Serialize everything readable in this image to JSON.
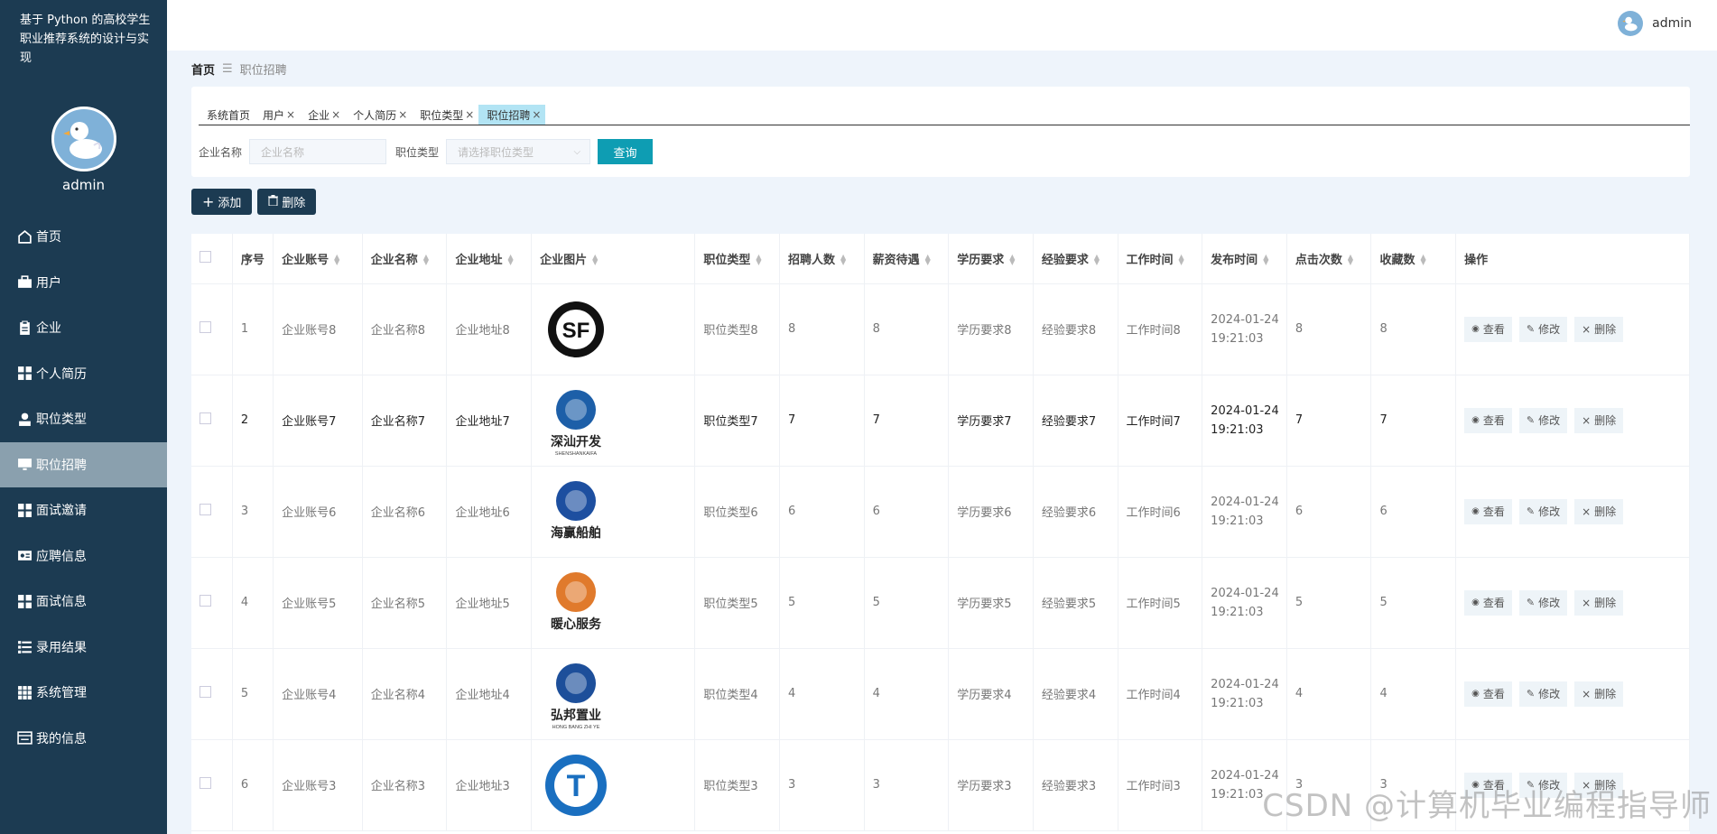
{
  "app": {
    "title": "基于 Python 的高校学生职业推荐系统的设计与实现"
  },
  "user": {
    "name": "admin"
  },
  "menu": [
    {
      "label": "首页",
      "icon": "home-icon"
    },
    {
      "label": "用户",
      "icon": "briefcase-icon"
    },
    {
      "label": "企业",
      "icon": "clipboard-icon"
    },
    {
      "label": "个人简历",
      "icon": "grid-icon"
    },
    {
      "label": "职位类型",
      "icon": "person-icon"
    },
    {
      "label": "职位招聘",
      "icon": "monitor-icon",
      "active": true
    },
    {
      "label": "面试邀请",
      "icon": "grid-icon"
    },
    {
      "label": "应聘信息",
      "icon": "id-card-icon"
    },
    {
      "label": "面试信息",
      "icon": "grid-icon"
    },
    {
      "label": "录用结果",
      "icon": "list-icon"
    },
    {
      "label": "系统管理",
      "icon": "apps-icon"
    },
    {
      "label": "我的信息",
      "icon": "profile-card-icon"
    }
  ],
  "breadcrumb": {
    "home": "首页",
    "current": "职位招聘"
  },
  "tabs": [
    {
      "label": "系统首页",
      "closable": false
    },
    {
      "label": "用户",
      "closable": true
    },
    {
      "label": "企业",
      "closable": true
    },
    {
      "label": "个人简历",
      "closable": true
    },
    {
      "label": "职位类型",
      "closable": true
    },
    {
      "label": "职位招聘",
      "closable": true,
      "active": true
    }
  ],
  "search": {
    "company_label": "企业名称",
    "company_placeholder": "企业名称",
    "type_label": "职位类型",
    "type_placeholder": "请选择职位类型",
    "query_button": "查询"
  },
  "actions": {
    "add": "添加",
    "delete": "删除"
  },
  "table": {
    "headers": [
      "序号",
      "企业账号",
      "企业名称",
      "企业地址",
      "企业图片",
      "职位类型",
      "招聘人数",
      "薪资待遇",
      "学历要求",
      "经验要求",
      "工作时间",
      "发布时间",
      "点击次数",
      "收藏数",
      "操作"
    ],
    "op_labels": {
      "view": "查看",
      "edit": "修改",
      "delete": "删除"
    },
    "rows": [
      {
        "no": "1",
        "account": "企业账号8",
        "name": "企业名称8",
        "address": "企业地址8",
        "logo": "SF",
        "type": "职位类型8",
        "count": "8",
        "salary": "8",
        "edu": "学历要求8",
        "exp": "经验要求8",
        "time": "工作时间8",
        "pub_date": "2024-01-24",
        "pub_time": "19:21:03",
        "clicks": "8",
        "favs": "8"
      },
      {
        "no": "2",
        "account": "企业账号7",
        "name": "企业名称7",
        "address": "企业地址7",
        "logo": "深汕开发",
        "logo_sub": "SHENSHANKAIFA",
        "type": "职位类型7",
        "count": "7",
        "salary": "7",
        "edu": "学历要求7",
        "exp": "经验要求7",
        "time": "工作时间7",
        "pub_date": "2024-01-24",
        "pub_time": "19:21:03",
        "clicks": "7",
        "favs": "7"
      },
      {
        "no": "3",
        "account": "企业账号6",
        "name": "企业名称6",
        "address": "企业地址6",
        "logo": "海赢船舶",
        "type": "职位类型6",
        "count": "6",
        "salary": "6",
        "edu": "学历要求6",
        "exp": "经验要求6",
        "time": "工作时间6",
        "pub_date": "2024-01-24",
        "pub_time": "19:21:03",
        "clicks": "6",
        "favs": "6"
      },
      {
        "no": "4",
        "account": "企业账号5",
        "name": "企业名称5",
        "address": "企业地址5",
        "logo": "暖心服务",
        "type": "职位类型5",
        "count": "5",
        "salary": "5",
        "edu": "学历要求5",
        "exp": "经验要求5",
        "time": "工作时间5",
        "pub_date": "2024-01-24",
        "pub_time": "19:21:03",
        "clicks": "5",
        "favs": "5"
      },
      {
        "no": "5",
        "account": "企业账号4",
        "name": "企业名称4",
        "address": "企业地址4",
        "logo": "弘邦置业",
        "logo_sub": "HONG BANG ZHI YE",
        "type": "职位类型4",
        "count": "4",
        "salary": "4",
        "edu": "学历要求4",
        "exp": "经验要求4",
        "time": "工作时间4",
        "pub_date": "2024-01-24",
        "pub_time": "19:21:03",
        "clicks": "4",
        "favs": "4"
      },
      {
        "no": "6",
        "account": "企业账号3",
        "name": "企业名称3",
        "address": "企业地址3",
        "logo": "T",
        "type": "职位类型3",
        "count": "3",
        "salary": "3",
        "edu": "学历要求3",
        "exp": "经验要求3",
        "time": "工作时间3",
        "pub_date": "2024-01-24",
        "pub_time": "19:21:03",
        "clicks": "3",
        "favs": "3"
      }
    ]
  },
  "watermark": "CSDN @计算机毕业编程指导师",
  "colors": {
    "sidebar": "#1c3b52",
    "active_tab": "#b2e4f4",
    "query": "#0e9db3",
    "background": "#eef4fb"
  }
}
